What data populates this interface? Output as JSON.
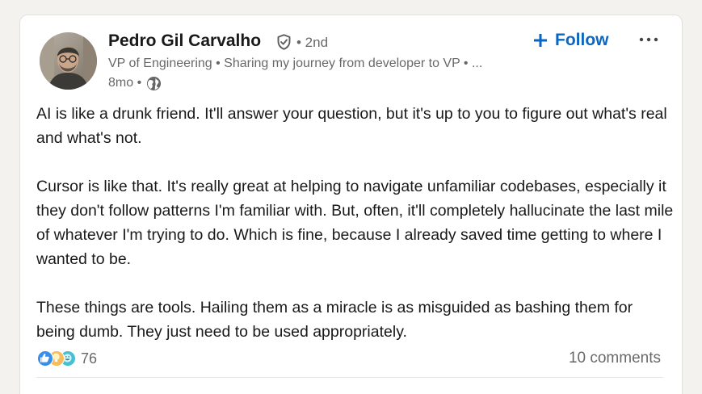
{
  "post": {
    "author": {
      "name": "Pedro Gil Carvalho",
      "degree": "• 2nd",
      "headline": "VP of Engineering • Sharing my journey from developer to VP • ...",
      "time": "8mo •"
    },
    "follow_label": "Follow",
    "paragraphs": [
      "AI is like a drunk friend. It'll answer your question, but it's up to you to figure out what's real and what's not.",
      "Cursor is like that. It's really great at helping to navigate unfamiliar codebases, especially it they don't follow patterns I'm familiar with. But, often, it'll completely hallucinate the last mile of whatever I'm trying to do. Which is fine, because I already saved time getting to where I wanted to be.",
      "These things are tools. Hailing them as a miracle is as misguided as bashing them for being dumb. They just need to be used appropriately."
    ],
    "reactions": {
      "count": "76",
      "icons": [
        "like-icon",
        "insightful-icon",
        "funny-icon"
      ]
    },
    "comments": "10 comments"
  },
  "colors": {
    "accent": "#0a66c2",
    "background": "#f4f2ee",
    "card": "#ffffff"
  }
}
